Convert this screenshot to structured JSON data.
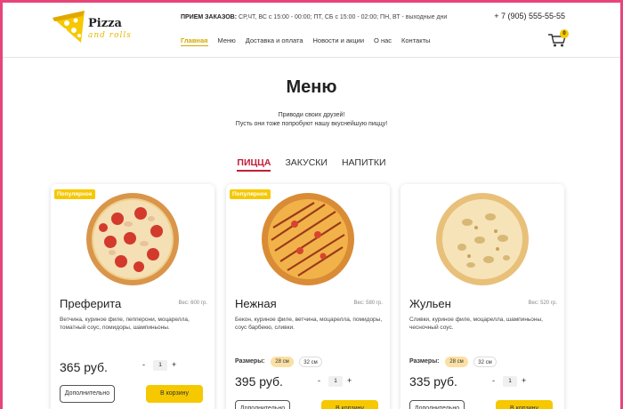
{
  "header": {
    "logo_word1": "Pizza",
    "logo_word2": "and rolls",
    "hours_label": "ПРИЕМ ЗАКАЗОВ:",
    "hours_text": " СР,ЧТ, ВС с 15:00 - 00:00; ПТ, СБ с 15:00 - 02:00; ПН, ВТ - выходные дни",
    "phone": "+ 7 (905) 555-55-55",
    "nav": [
      "Главная",
      "Меню",
      "Доставка и оплата",
      "Новости и акции",
      "О нас",
      "Контакты"
    ],
    "cart_count": "0"
  },
  "main": {
    "title": "Меню",
    "subtitle_line1": "Приводи своих друзей!",
    "subtitle_line2": "Пусть они тоже попробуют нашу вкуснейшую пиццу!",
    "tabs": [
      "ПИЦЦА",
      "ЗАКУСКИ",
      "НАПИТКИ"
    ]
  },
  "cards": [
    {
      "badge": "Популярное",
      "name": "Преферита",
      "weight": "Вес: 600 гр.",
      "desc": "Ветчина, куриное филе, пепперони, моцарелла, томатный соус, помидоры, шампиньоны.",
      "price": "365 руб.",
      "qty": "1",
      "more": "Дополнительно",
      "cart": "В корзину"
    },
    {
      "badge": "Популярное",
      "name": "Нежная",
      "weight": "Вес: 580 гр.",
      "desc": "Бекон, куриное филе, ветчина, моцарелла, помидоры, соус барбекю, сливки.",
      "sizes_label": "Размеры:",
      "size1": "28 см",
      "size2": "32 см",
      "price": "395 руб.",
      "qty": "1",
      "more": "Дополнительно",
      "cart": "В корзину"
    },
    {
      "name": "Жульен",
      "weight": "Вес: 520 гр.",
      "desc": "Сливки, куриное филе, моцарелла, шампиньоны, чесночный соус.",
      "sizes_label": "Размеры:",
      "size1": "28 см",
      "size2": "32 см",
      "price": "335 руб.",
      "qty": "1",
      "more": "Дополнительно",
      "cart": "В корзину"
    }
  ],
  "colors": {
    "accent": "#f6c800",
    "active_tab": "#c21e3a",
    "frame": "#e6457a"
  }
}
